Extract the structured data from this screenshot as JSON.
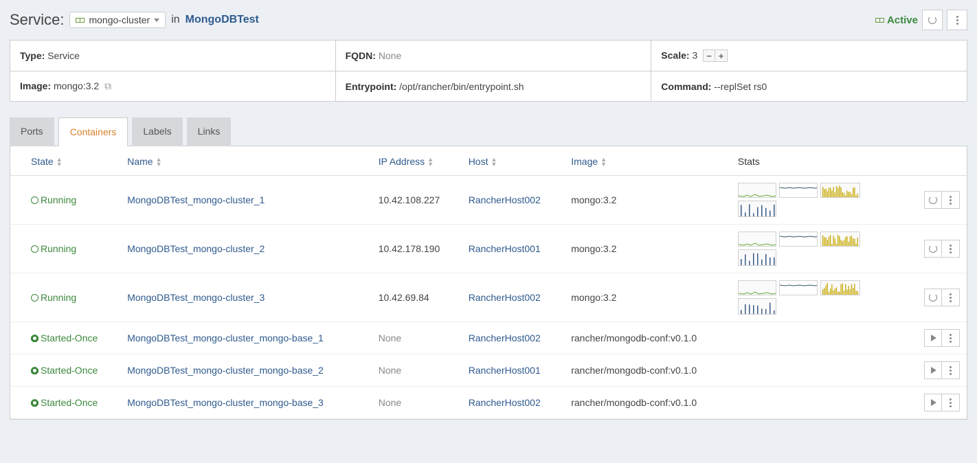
{
  "header": {
    "service_label": "Service:",
    "service_name": "mongo-cluster",
    "in_label": "in",
    "stack_name": "MongoDBTest",
    "status": "Active"
  },
  "info": {
    "type_label": "Type:",
    "type_val": "Service",
    "fqdn_label": "FQDN:",
    "fqdn_val": "None",
    "scale_label": "Scale:",
    "scale_val": "3",
    "image_label": "Image:",
    "image_val": "mongo:3.2",
    "entry_label": "Entrypoint:",
    "entry_val": "/opt/rancher/bin/entrypoint.sh",
    "cmd_label": "Command:",
    "cmd_val": "--replSet rs0"
  },
  "tabs": {
    "ports": "Ports",
    "containers": "Containers",
    "labels": "Labels",
    "links": "Links"
  },
  "cols": {
    "state": "State",
    "name": "Name",
    "ip": "IP Address",
    "host": "Host",
    "image": "Image",
    "stats": "Stats"
  },
  "rows": [
    {
      "state": "Running",
      "state_kind": "run",
      "name": "MongoDBTest_mongo-cluster_1",
      "ip": "10.42.108.227",
      "host": "RancherHost002",
      "image": "mongo:3.2",
      "has_charts": true,
      "action": "refresh"
    },
    {
      "state": "Running",
      "state_kind": "run",
      "name": "MongoDBTest_mongo-cluster_2",
      "ip": "10.42.178.190",
      "host": "RancherHost001",
      "image": "mongo:3.2",
      "has_charts": true,
      "action": "refresh"
    },
    {
      "state": "Running",
      "state_kind": "run",
      "name": "MongoDBTest_mongo-cluster_3",
      "ip": "10.42.69.84",
      "host": "RancherHost002",
      "image": "mongo:3.2",
      "has_charts": true,
      "action": "refresh"
    },
    {
      "state": "Started-Once",
      "state_kind": "once",
      "name": "MongoDBTest_mongo-cluster_mongo-base_1",
      "ip": "None",
      "host": "RancherHost002",
      "image": "rancher/mongodb-conf:v0.1.0",
      "has_charts": false,
      "action": "play"
    },
    {
      "state": "Started-Once",
      "state_kind": "once",
      "name": "MongoDBTest_mongo-cluster_mongo-base_2",
      "ip": "None",
      "host": "RancherHost001",
      "image": "rancher/mongodb-conf:v0.1.0",
      "has_charts": false,
      "action": "play"
    },
    {
      "state": "Started-Once",
      "state_kind": "once",
      "name": "MongoDBTest_mongo-cluster_mongo-base_3",
      "ip": "None",
      "host": "RancherHost002",
      "image": "rancher/mongodb-conf:v0.1.0",
      "has_charts": false,
      "action": "play"
    }
  ]
}
